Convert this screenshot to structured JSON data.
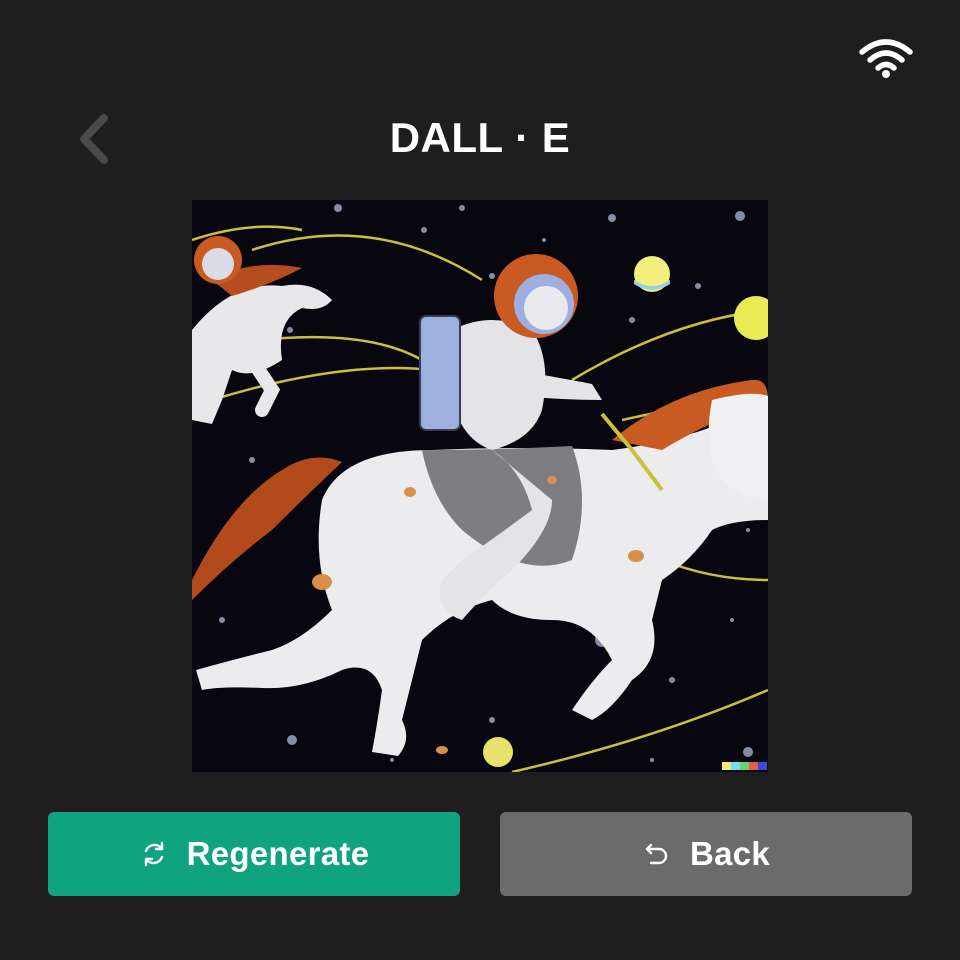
{
  "header": {
    "title": "DALL · E",
    "back_icon": "chevron-left-icon",
    "status_icon": "wifi-icon"
  },
  "artwork": {
    "subject": "astronaut-on-horse-artwork"
  },
  "actions": {
    "regenerate_label": "Regenerate",
    "regenerate_icon": "refresh-icon",
    "back_label": "Back",
    "back_icon": "undo-icon"
  },
  "colors": {
    "background": "#1e1e1e",
    "accent": "#10a37f",
    "secondary_button": "#6b6b6b"
  }
}
